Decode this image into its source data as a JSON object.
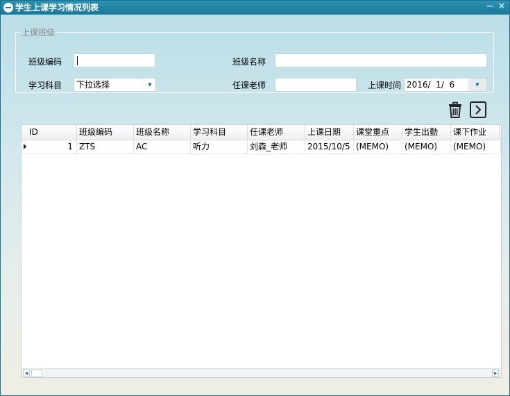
{
  "window": {
    "title": "学生上课学习情况列表",
    "minimize_glyph": "−",
    "close_glyph": "✕"
  },
  "group": {
    "legend": "上课班级",
    "class_code_label": "班级编码",
    "class_code_value": "",
    "class_name_label": "班级名称",
    "class_name_value": "",
    "subject_label": "学习科目",
    "subject_value": "下拉选择",
    "teacher_label": "任课老师",
    "teacher_value": "",
    "time_label": "上课时间",
    "time_value": "2016/  1/  6"
  },
  "toolbar": {
    "delete_icon": "trash-icon",
    "next_icon": "chevron-right-icon"
  },
  "grid": {
    "columns": [
      "ID",
      "班级编码",
      "班级名称",
      "学习科目",
      "任课老师",
      "上课日期",
      "课堂重点",
      "学生出勤",
      "课下作业"
    ],
    "rows": [
      {
        "id": "1",
        "class_code": "ZTS",
        "class_name": "AC",
        "subject": "听力",
        "teacher": "刘森_老师",
        "date": "2015/10/5",
        "key_points": "(MEMO)",
        "attendance": "(MEMO)",
        "homework": "(MEMO)"
      }
    ]
  },
  "colors": {
    "titlebar": "#1a7799",
    "accent": "#2d93b4"
  }
}
